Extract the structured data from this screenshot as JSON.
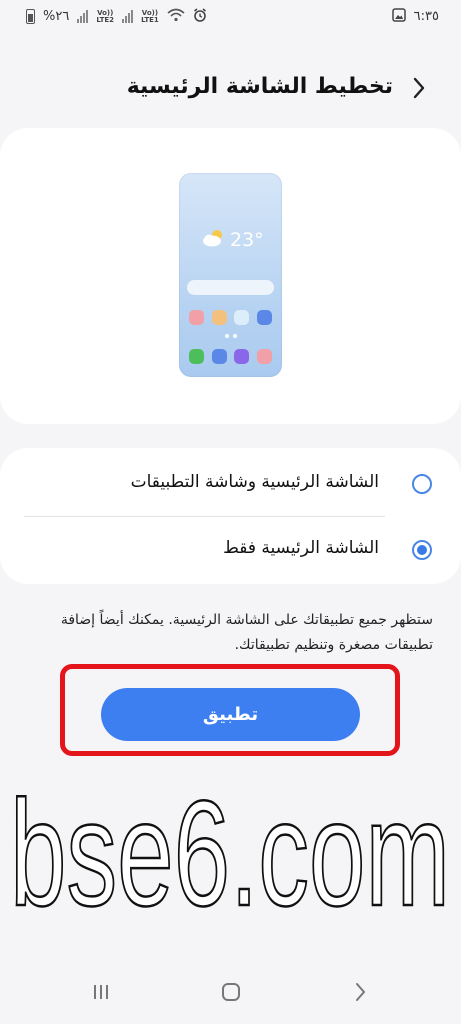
{
  "status_bar": {
    "battery": "%٢٦",
    "net1": "LTE2",
    "net2": "LTE1",
    "volte": "Vo))",
    "time": "٦:٣٥"
  },
  "header": {
    "title": "تخطيط الشاشة الرئيسية",
    "back_icon": "chevron-right-icon"
  },
  "preview": {
    "temperature": "23°",
    "weather_icon": "partly-cloudy-icon",
    "app_row1_colors": [
      "#f2a0a8",
      "#f3c07d",
      "#dceefa",
      "#5b87e6"
    ],
    "app_row2_colors": [
      "#4cbf5c",
      "#5b87e6",
      "#8a66e8",
      "#f2a0a8"
    ]
  },
  "options": [
    {
      "label": "الشاشة الرئيسية وشاشة التطبيقات",
      "selected": false
    },
    {
      "label": "الشاشة الرئيسية فقط",
      "selected": true
    }
  ],
  "description": "ستظهر جميع تطبيقاتك على الشاشة الرئيسية. يمكنك أيضاً إضافة تطبيقات مصغرة وتنظيم تطبيقاتك.",
  "apply_button": {
    "label": "تطبيق"
  },
  "watermark": {
    "text": "bse6.com"
  },
  "nav_bar": {
    "recents_icon": "recents-icon",
    "home_icon": "home-icon",
    "back_icon": "back-icon"
  },
  "colors": {
    "accent": "#3d7ff1",
    "highlight": "#e3141a",
    "background": "#f5f5f7"
  }
}
